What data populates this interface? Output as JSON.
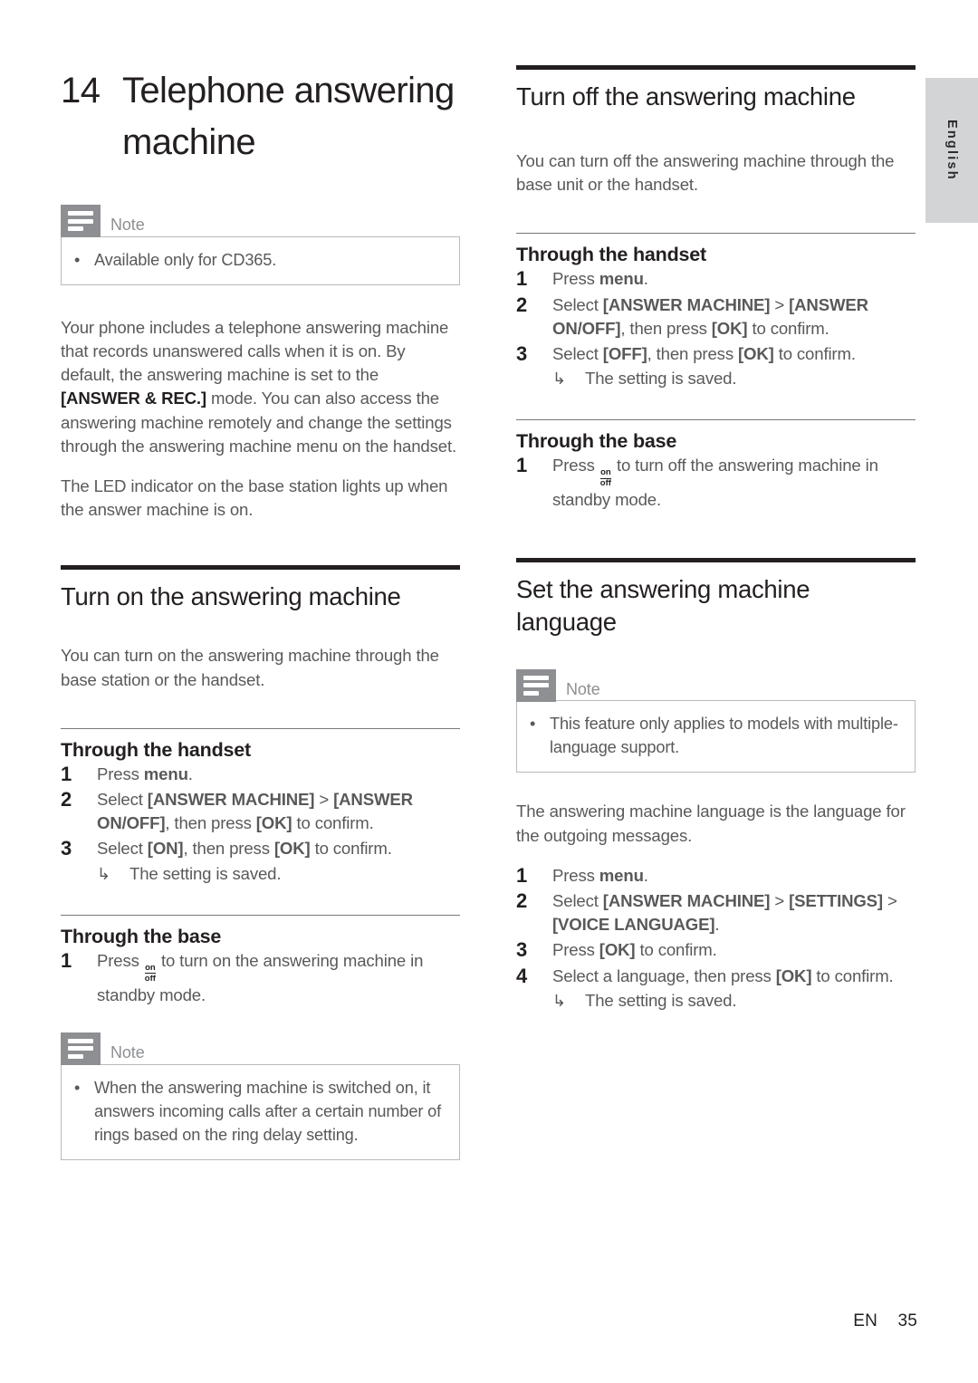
{
  "language_tab": {
    "label": "English"
  },
  "chapter": {
    "number": "14",
    "title": "Telephone answering machine"
  },
  "notes": {
    "label": "Note",
    "intro_items": [
      "Available only for CD365."
    ],
    "turn_on_items": [
      "When the answering machine is switched on, it answers incoming calls after a certain number of rings based on the ring delay setting."
    ],
    "language_items": [
      "This feature only applies to models with multiple-language support."
    ]
  },
  "intro": {
    "paragraph_1_before": "Your phone includes a telephone answering machine that records unanswered calls when it is on. By default, the answering machine is set to the ",
    "paragraph_1_bold": "[ANSWER & REC.]",
    "paragraph_1_after": " mode. You can also access the answering machine remotely and change the settings through the answering machine menu on the handset.",
    "paragraph_2": "The LED indicator on the base station lights up when the answer machine is on."
  },
  "turn_on": {
    "heading": "Turn on the answering machine",
    "intro": "You can turn on the answering machine through the base station or the handset.",
    "handset_heading": "Through the handset",
    "handset_steps": [
      {
        "num": "1",
        "pre": "Press ",
        "bold": "menu",
        "post": "."
      },
      {
        "num": "2",
        "pre": "Select ",
        "bold": "[ANSWER MACHINE]",
        "mid": " > ",
        "bold2": "[ANSWER ON/OFF]",
        "post": ", then press ",
        "bold3": "[OK]",
        "tail": " to confirm."
      },
      {
        "num": "3",
        "pre": "Select ",
        "bold": "[ON]",
        "post": ", then press ",
        "bold3": "[OK]",
        "tail": " to confirm.",
        "result": "The setting is saved."
      }
    ],
    "base_heading": "Through the base",
    "base_step": {
      "num": "1",
      "pre": "Press ",
      "key_top": "on",
      "key_bottom": "off",
      "post": " to turn on the answering machine in standby mode."
    }
  },
  "turn_off": {
    "heading": "Turn off the answering machine",
    "intro": "You can turn off the answering machine through the base unit or the handset.",
    "handset_heading": "Through the handset",
    "handset_steps": [
      {
        "num": "1",
        "pre": "Press ",
        "bold": "menu",
        "post": "."
      },
      {
        "num": "2",
        "pre": "Select ",
        "bold": "[ANSWER MACHINE]",
        "mid": " > ",
        "bold2": "[ANSWER ON/OFF]",
        "post": ", then press ",
        "bold3": "[OK]",
        "tail": " to confirm."
      },
      {
        "num": "3",
        "pre": "Select ",
        "bold": "[OFF]",
        "post": ", then press ",
        "bold3": "[OK]",
        "tail": " to confirm.",
        "result": "The setting is saved."
      }
    ],
    "base_heading": "Through the base",
    "base_step": {
      "num": "1",
      "pre": "Press ",
      "key_top": "on",
      "key_bottom": "off",
      "post": " to turn off the answering machine in standby mode."
    }
  },
  "set_language": {
    "heading": "Set the answering machine language",
    "intro": "The answering machine language is the language for the outgoing messages.",
    "steps": [
      {
        "num": "1",
        "pre": "Press ",
        "bold": "menu",
        "post": "."
      },
      {
        "num": "2",
        "pre": "Select ",
        "bold": "[ANSWER MACHINE]",
        "mid": " > ",
        "bold2": "[SETTINGS]",
        "mid2": " > ",
        "bold3": "[VOICE LANGUAGE]",
        "tail": "."
      },
      {
        "num": "3",
        "pre": "Press ",
        "bold3": "[OK]",
        "tail": " to confirm."
      },
      {
        "num": "4",
        "pre": "Select a language, then press ",
        "bold3": "[OK]",
        "tail": " to confirm.",
        "result": "The setting is saved."
      }
    ]
  },
  "footer": {
    "locale": "EN",
    "page": "35"
  },
  "icons": {
    "arrow": "↳",
    "bullet": "•"
  }
}
